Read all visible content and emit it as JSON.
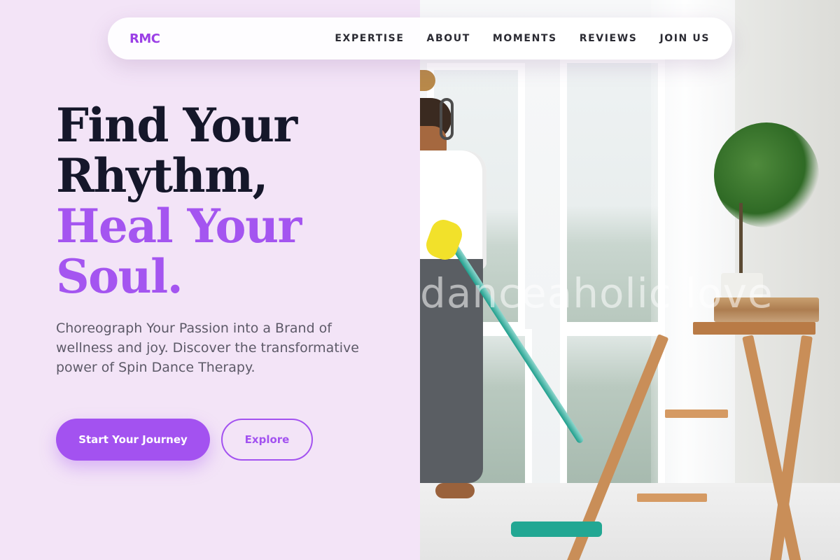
{
  "nav": {
    "logo": "RMC",
    "links": [
      "EXPERTISE",
      "ABOUT",
      "MOMENTS",
      "REVIEWS",
      "JOIN US"
    ]
  },
  "hero": {
    "title_line1": "Find Your",
    "title_line2": "Rhythm,",
    "title_accent_line1": "Heal Your",
    "title_accent_line2": "Soul.",
    "description": "Choreograph Your Passion into a Brand of wellness and joy. Discover the transformative power of Spin Dance Therapy.",
    "primary_button": "Start Your Journey",
    "secondary_button": "Explore"
  },
  "image": {
    "overlay_text": "danceaholic love"
  },
  "colors": {
    "accent": "#a352f0",
    "background": "#f3e4f7",
    "heading": "#15172a"
  }
}
